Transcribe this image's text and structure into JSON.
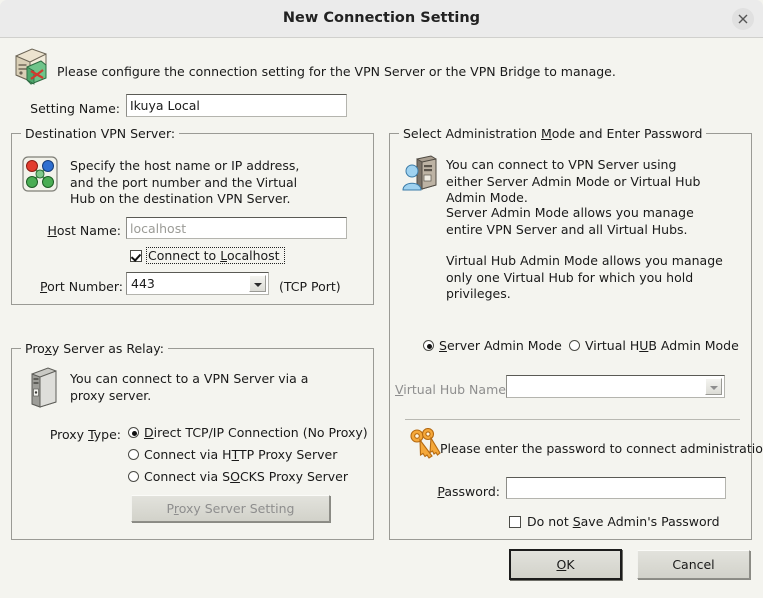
{
  "window": {
    "title": "New Connection Setting",
    "close_icon": "close-icon"
  },
  "header": {
    "icon": "vpn-server-icon",
    "description": "Please configure the connection setting for the VPN Server or the VPN Bridge to manage."
  },
  "setting_name": {
    "label": "Setting Name:",
    "value": "Ikuya Local"
  },
  "destination": {
    "group_title": "Destination VPN Server:",
    "icon": "virtual-hub-icon",
    "description": "Specify the host name or IP address, and the port number and the Virtual Hub on the destination VPN Server.",
    "host_name_label": "Host Name:",
    "host_name_placeholder": "localhost",
    "host_name_value": "",
    "connect_localhost_label": "Connect to Localhost",
    "connect_localhost_checked": true,
    "port_label": "Port Number:",
    "port_value": "443",
    "port_suffix": "(TCP Port)"
  },
  "proxy": {
    "group_title": "Proxy Server as Relay:",
    "icon": "computer-tower-icon",
    "description": "You can connect to a VPN Server via a proxy server.",
    "type_label": "Proxy Type:",
    "options": [
      {
        "label": "Direct TCP/IP Connection (No Proxy)",
        "selected": true
      },
      {
        "label": "Connect via HTTP Proxy Server",
        "selected": false
      },
      {
        "label": "Connect via SOCKS Proxy Server",
        "selected": false
      }
    ],
    "settings_button": "Proxy Server Setting",
    "settings_button_enabled": false
  },
  "admin": {
    "group_title": "Select Administration Mode and Enter Password",
    "icon": "admin-user-server-icon",
    "paragraphs": [
      "You can connect to VPN Server using either Server Admin Mode or Virtual Hub Admin Mode.",
      "Server Admin Mode allows you manage entire VPN Server and all Virtual Hubs.",
      "Virtual Hub Admin Mode allows you manage only one Virtual Hub for which you hold privileges."
    ],
    "mode_options": [
      {
        "label": "Server Admin Mode",
        "selected": true
      },
      {
        "label": "Virtual HUB Admin Mode",
        "selected": false
      }
    ],
    "virtual_hub_label": "Virtual Hub Name:",
    "virtual_hub_value": "",
    "virtual_hub_enabled": false,
    "password_icon": "keys-icon",
    "password_prompt": "Please enter the password to connect administration mode.",
    "password_label": "Password:",
    "password_value": "",
    "do_not_save_label": "Do not Save Admin's Password",
    "do_not_save_checked": false
  },
  "footer": {
    "ok_label": "OK",
    "cancel_label": "Cancel"
  },
  "colors": {
    "titlebar_bg": "#ebebeb",
    "body_bg": "#f4f4ef",
    "border": "#9a9a95",
    "text": "#1a1a1a",
    "disabled_text": "#8e8e8e"
  }
}
